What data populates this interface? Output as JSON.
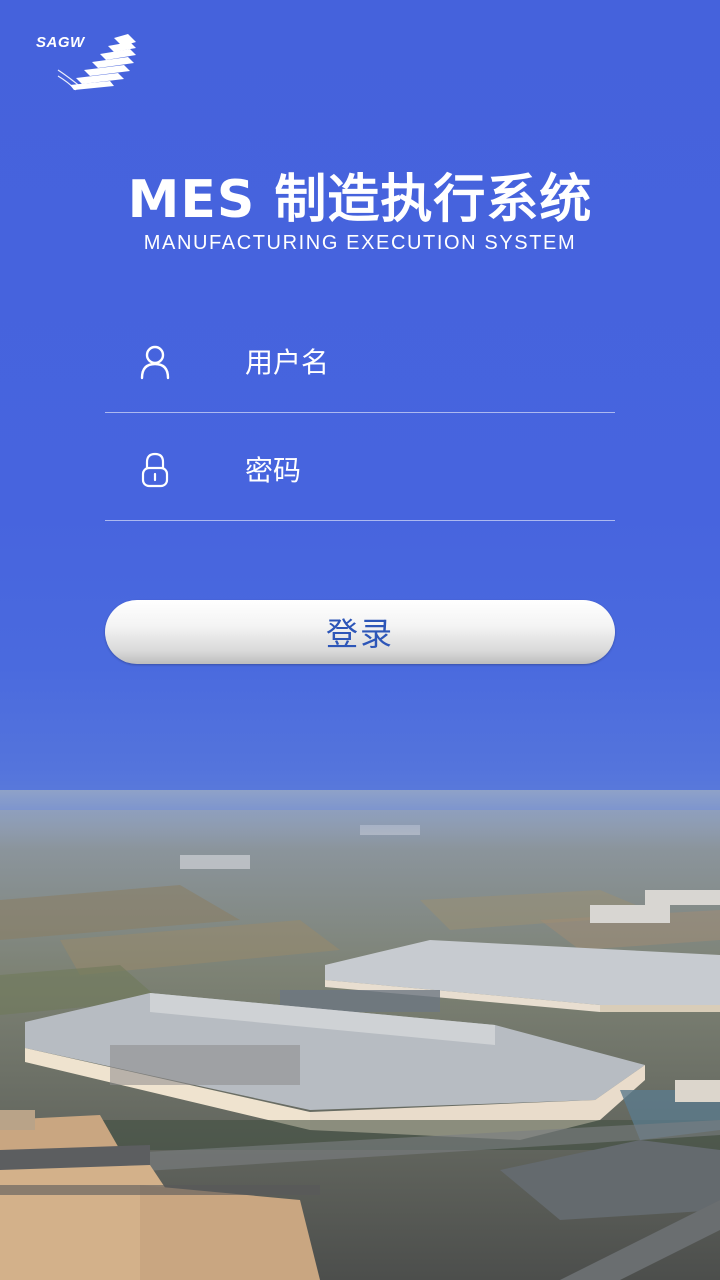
{
  "brand": {
    "logo_text": "SAGW",
    "logo_icon": "sagw-stripes-logo"
  },
  "header": {
    "title": "MES 制造执行系统",
    "subtitle": "MANUFACTURING EXECUTION SYSTEM"
  },
  "form": {
    "username": {
      "icon": "user-icon",
      "placeholder": "用户名",
      "value": ""
    },
    "password": {
      "icon": "lock-icon",
      "placeholder": "密码",
      "value": ""
    },
    "login_label": "登录"
  },
  "colors": {
    "background_top": "#4562dc",
    "button_text": "#2d56b8",
    "text": "#ffffff"
  }
}
